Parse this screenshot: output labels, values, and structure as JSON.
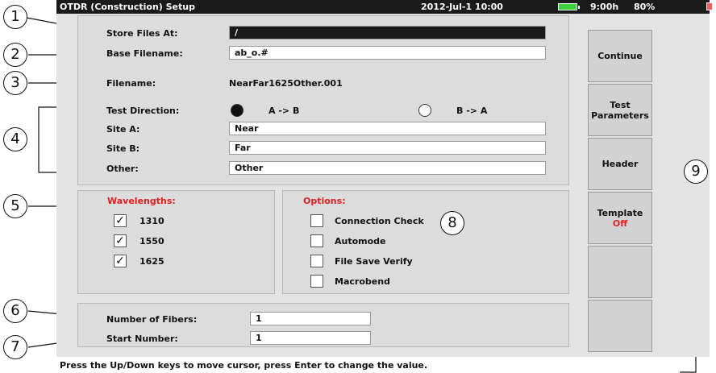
{
  "header": {
    "title": "OTDR (Construction) Setup",
    "datetime": "2012-Jul-1 10:00",
    "time_remaining": "9:00h",
    "battery_percent": "80%"
  },
  "file": {
    "store_label": "Store Files At:",
    "store_value": "/",
    "base_label": "Base Filename:",
    "base_value": "ab_o.#",
    "filename_label": "Filename:",
    "filename_value": "NearFar1625Other.001"
  },
  "direction": {
    "label": "Test Direction:",
    "option_ab": "A -> B",
    "option_ba": "B -> A",
    "selected": "A -> B"
  },
  "sites": {
    "site_a_label": "Site A:",
    "site_a_value": "Near",
    "site_b_label": "Site B:",
    "site_b_value": "Far",
    "other_label": "Other:",
    "other_value": "Other"
  },
  "wavelengths": {
    "label": "Wavelengths:",
    "items": [
      {
        "label": "1310",
        "checked": true
      },
      {
        "label": "1550",
        "checked": true
      },
      {
        "label": "1625",
        "checked": true
      }
    ]
  },
  "options": {
    "label": "Options:",
    "items": [
      {
        "label": "Connection Check",
        "checked": false
      },
      {
        "label": "Automode",
        "checked": false
      },
      {
        "label": "File Save Verify",
        "checked": false
      },
      {
        "label": "Macrobend",
        "checked": false
      }
    ]
  },
  "fibers": {
    "count_label": "Number of Fibers:",
    "count_value": "1",
    "start_label": "Start Number:",
    "start_value": "1"
  },
  "sidebar": {
    "continue": "Continue",
    "test_params_1": "Test",
    "test_params_2": "Parameters",
    "header": "Header",
    "template": "Template",
    "template_state": "Off"
  },
  "help_text": "Press the Up/Down keys to move cursor, press Enter to change the value.",
  "callouts": [
    "1",
    "2",
    "3",
    "4",
    "5",
    "6",
    "7",
    "8",
    "9"
  ],
  "colors": {
    "accent_red": "#e02020",
    "battery_green": "#3ecf3e"
  }
}
